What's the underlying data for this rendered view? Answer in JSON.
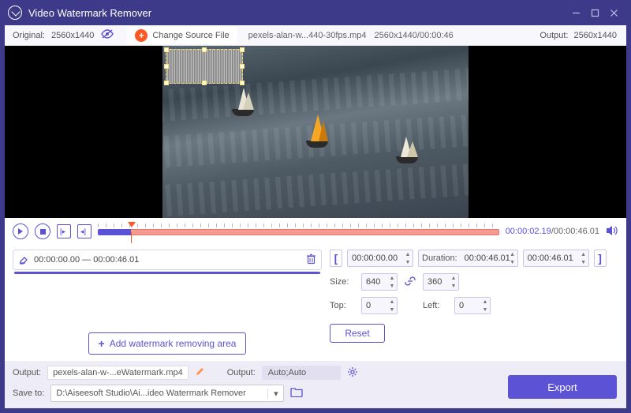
{
  "app": {
    "title": "Video Watermark Remover"
  },
  "infobar": {
    "original_label": "Original:",
    "original_res": "2560x1440",
    "change_source": "Change Source File",
    "filename": "pexels-alan-w...440-30fps.mp4",
    "file_meta": "2560x1440/00:00:46",
    "output_label": "Output:",
    "output_res": "2560x1440"
  },
  "playback": {
    "current": "00:00:02.19",
    "total": "00:00:46.01"
  },
  "segment": {
    "range": "00:00:00.00 — 00:00:46.01"
  },
  "add_area_btn": "Add watermark removing area",
  "trim": {
    "start": "00:00:00.00",
    "duration_label": "Duration:",
    "duration": "00:00:46.01",
    "end": "00:00:46.01"
  },
  "size": {
    "label": "Size:",
    "w": "640",
    "h": "360"
  },
  "pos": {
    "top_label": "Top:",
    "top": "0",
    "left_label": "Left:",
    "left": "0"
  },
  "reset_btn": "Reset",
  "bottom": {
    "output_label": "Output:",
    "output_name": "pexels-alan-w-...eWatermark.mp4",
    "output_fmt_label": "Output:",
    "output_fmt": "Auto;Auto",
    "save_to_label": "Save to:",
    "save_path": "D:\\Aiseesoft Studio\\Ai...ideo Watermark Remover",
    "export": "Export"
  }
}
